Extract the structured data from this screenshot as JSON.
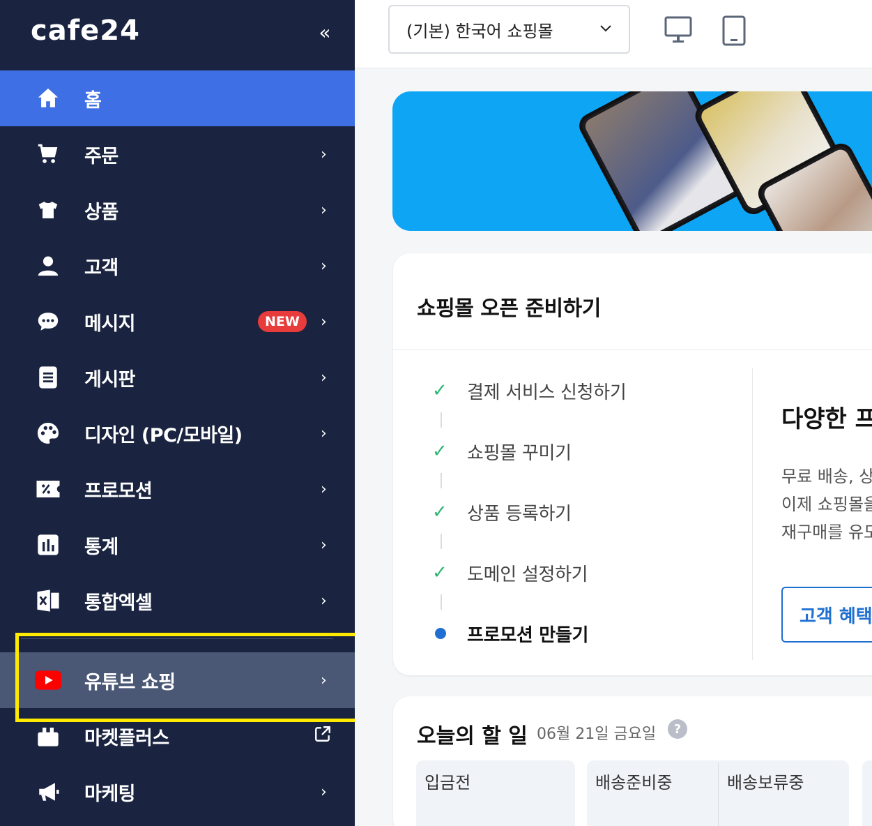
{
  "sidebar": {
    "brand": "cafe24",
    "items": [
      {
        "label": "홈"
      },
      {
        "label": "주문"
      },
      {
        "label": "상품"
      },
      {
        "label": "고객"
      },
      {
        "label": "메시지",
        "badge": "NEW"
      },
      {
        "label": "게시판"
      },
      {
        "label": "디자인 (PC/모바일)"
      },
      {
        "label": "프로모션"
      },
      {
        "label": "통계"
      },
      {
        "label": "통합엑셀"
      },
      {
        "label": "유튜브 쇼핑"
      },
      {
        "label": "마켓플러스"
      },
      {
        "label": "마케팅"
      }
    ]
  },
  "topbar": {
    "shop_select": "(기본) 한국어 쇼핑몰"
  },
  "open_card": {
    "title": "쇼핑몰 오픈 준비하기",
    "steps": [
      {
        "label": "결제 서비스 신청하기",
        "done": true
      },
      {
        "label": "쇼핑몰 꾸미기",
        "done": true
      },
      {
        "label": "상품 등록하기",
        "done": true
      },
      {
        "label": "도메인 설정하기",
        "done": true
      },
      {
        "label": "프로모션 만들기",
        "done": false
      }
    ],
    "promo_title": "다양한 프",
    "promo_lines": [
      "무료 배송, 상",
      "이제 쇼핑몰을",
      "재구매를 유도"
    ],
    "promo_button": "고객 혜택"
  },
  "todo": {
    "title": "오늘의 할 일",
    "date": "06월 21일 금요일",
    "help": "?",
    "tiles": [
      "입금전",
      "배송준비중",
      "배송보류중"
    ]
  },
  "colors": {
    "sidebar_bg": "#1a2440",
    "active_bg": "#3f6fe4",
    "accent_blue": "#1f6fd1",
    "highlight": "#ffea00",
    "banner": "#0ea5f5"
  }
}
